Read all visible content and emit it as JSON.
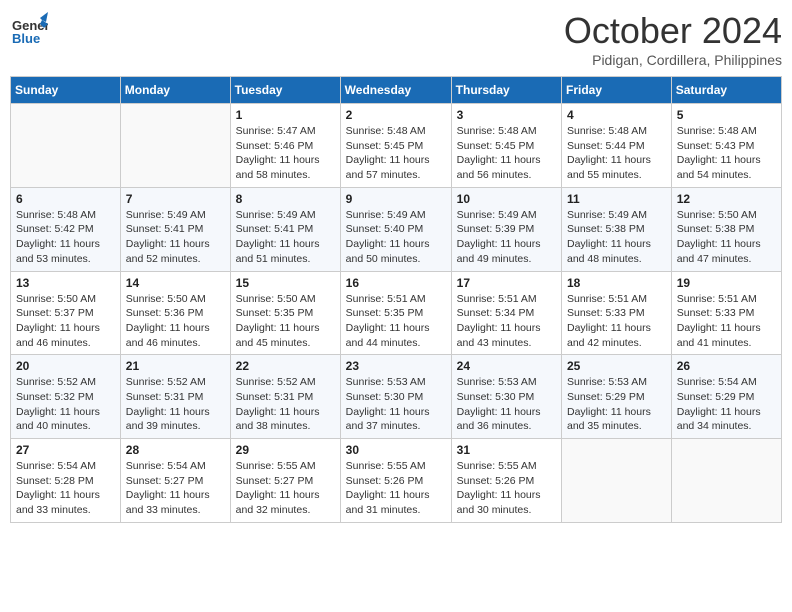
{
  "logo": {
    "general": "General",
    "blue": "Blue"
  },
  "title": "October 2024",
  "subtitle": "Pidigan, Cordillera, Philippines",
  "days_of_week": [
    "Sunday",
    "Monday",
    "Tuesday",
    "Wednesday",
    "Thursday",
    "Friday",
    "Saturday"
  ],
  "weeks": [
    [
      {
        "day": "",
        "sunrise": "",
        "sunset": "",
        "daylight": ""
      },
      {
        "day": "",
        "sunrise": "",
        "sunset": "",
        "daylight": ""
      },
      {
        "day": "1",
        "sunrise": "Sunrise: 5:47 AM",
        "sunset": "Sunset: 5:46 PM",
        "daylight": "Daylight: 11 hours and 58 minutes."
      },
      {
        "day": "2",
        "sunrise": "Sunrise: 5:48 AM",
        "sunset": "Sunset: 5:45 PM",
        "daylight": "Daylight: 11 hours and 57 minutes."
      },
      {
        "day": "3",
        "sunrise": "Sunrise: 5:48 AM",
        "sunset": "Sunset: 5:45 PM",
        "daylight": "Daylight: 11 hours and 56 minutes."
      },
      {
        "day": "4",
        "sunrise": "Sunrise: 5:48 AM",
        "sunset": "Sunset: 5:44 PM",
        "daylight": "Daylight: 11 hours and 55 minutes."
      },
      {
        "day": "5",
        "sunrise": "Sunrise: 5:48 AM",
        "sunset": "Sunset: 5:43 PM",
        "daylight": "Daylight: 11 hours and 54 minutes."
      }
    ],
    [
      {
        "day": "6",
        "sunrise": "Sunrise: 5:48 AM",
        "sunset": "Sunset: 5:42 PM",
        "daylight": "Daylight: 11 hours and 53 minutes."
      },
      {
        "day": "7",
        "sunrise": "Sunrise: 5:49 AM",
        "sunset": "Sunset: 5:41 PM",
        "daylight": "Daylight: 11 hours and 52 minutes."
      },
      {
        "day": "8",
        "sunrise": "Sunrise: 5:49 AM",
        "sunset": "Sunset: 5:41 PM",
        "daylight": "Daylight: 11 hours and 51 minutes."
      },
      {
        "day": "9",
        "sunrise": "Sunrise: 5:49 AM",
        "sunset": "Sunset: 5:40 PM",
        "daylight": "Daylight: 11 hours and 50 minutes."
      },
      {
        "day": "10",
        "sunrise": "Sunrise: 5:49 AM",
        "sunset": "Sunset: 5:39 PM",
        "daylight": "Daylight: 11 hours and 49 minutes."
      },
      {
        "day": "11",
        "sunrise": "Sunrise: 5:49 AM",
        "sunset": "Sunset: 5:38 PM",
        "daylight": "Daylight: 11 hours and 48 minutes."
      },
      {
        "day": "12",
        "sunrise": "Sunrise: 5:50 AM",
        "sunset": "Sunset: 5:38 PM",
        "daylight": "Daylight: 11 hours and 47 minutes."
      }
    ],
    [
      {
        "day": "13",
        "sunrise": "Sunrise: 5:50 AM",
        "sunset": "Sunset: 5:37 PM",
        "daylight": "Daylight: 11 hours and 46 minutes."
      },
      {
        "day": "14",
        "sunrise": "Sunrise: 5:50 AM",
        "sunset": "Sunset: 5:36 PM",
        "daylight": "Daylight: 11 hours and 46 minutes."
      },
      {
        "day": "15",
        "sunrise": "Sunrise: 5:50 AM",
        "sunset": "Sunset: 5:35 PM",
        "daylight": "Daylight: 11 hours and 45 minutes."
      },
      {
        "day": "16",
        "sunrise": "Sunrise: 5:51 AM",
        "sunset": "Sunset: 5:35 PM",
        "daylight": "Daylight: 11 hours and 44 minutes."
      },
      {
        "day": "17",
        "sunrise": "Sunrise: 5:51 AM",
        "sunset": "Sunset: 5:34 PM",
        "daylight": "Daylight: 11 hours and 43 minutes."
      },
      {
        "day": "18",
        "sunrise": "Sunrise: 5:51 AM",
        "sunset": "Sunset: 5:33 PM",
        "daylight": "Daylight: 11 hours and 42 minutes."
      },
      {
        "day": "19",
        "sunrise": "Sunrise: 5:51 AM",
        "sunset": "Sunset: 5:33 PM",
        "daylight": "Daylight: 11 hours and 41 minutes."
      }
    ],
    [
      {
        "day": "20",
        "sunrise": "Sunrise: 5:52 AM",
        "sunset": "Sunset: 5:32 PM",
        "daylight": "Daylight: 11 hours and 40 minutes."
      },
      {
        "day": "21",
        "sunrise": "Sunrise: 5:52 AM",
        "sunset": "Sunset: 5:31 PM",
        "daylight": "Daylight: 11 hours and 39 minutes."
      },
      {
        "day": "22",
        "sunrise": "Sunrise: 5:52 AM",
        "sunset": "Sunset: 5:31 PM",
        "daylight": "Daylight: 11 hours and 38 minutes."
      },
      {
        "day": "23",
        "sunrise": "Sunrise: 5:53 AM",
        "sunset": "Sunset: 5:30 PM",
        "daylight": "Daylight: 11 hours and 37 minutes."
      },
      {
        "day": "24",
        "sunrise": "Sunrise: 5:53 AM",
        "sunset": "Sunset: 5:30 PM",
        "daylight": "Daylight: 11 hours and 36 minutes."
      },
      {
        "day": "25",
        "sunrise": "Sunrise: 5:53 AM",
        "sunset": "Sunset: 5:29 PM",
        "daylight": "Daylight: 11 hours and 35 minutes."
      },
      {
        "day": "26",
        "sunrise": "Sunrise: 5:54 AM",
        "sunset": "Sunset: 5:29 PM",
        "daylight": "Daylight: 11 hours and 34 minutes."
      }
    ],
    [
      {
        "day": "27",
        "sunrise": "Sunrise: 5:54 AM",
        "sunset": "Sunset: 5:28 PM",
        "daylight": "Daylight: 11 hours and 33 minutes."
      },
      {
        "day": "28",
        "sunrise": "Sunrise: 5:54 AM",
        "sunset": "Sunset: 5:27 PM",
        "daylight": "Daylight: 11 hours and 33 minutes."
      },
      {
        "day": "29",
        "sunrise": "Sunrise: 5:55 AM",
        "sunset": "Sunset: 5:27 PM",
        "daylight": "Daylight: 11 hours and 32 minutes."
      },
      {
        "day": "30",
        "sunrise": "Sunrise: 5:55 AM",
        "sunset": "Sunset: 5:26 PM",
        "daylight": "Daylight: 11 hours and 31 minutes."
      },
      {
        "day": "31",
        "sunrise": "Sunrise: 5:55 AM",
        "sunset": "Sunset: 5:26 PM",
        "daylight": "Daylight: 11 hours and 30 minutes."
      },
      {
        "day": "",
        "sunrise": "",
        "sunset": "",
        "daylight": ""
      },
      {
        "day": "",
        "sunrise": "",
        "sunset": "",
        "daylight": ""
      }
    ]
  ]
}
